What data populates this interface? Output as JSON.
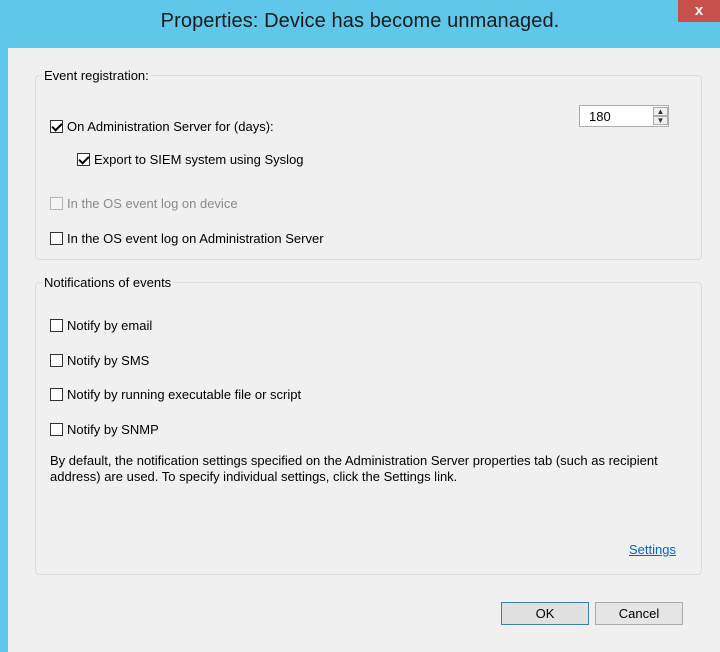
{
  "window": {
    "title": "Properties: Device has become unmanaged.",
    "close_label": "x"
  },
  "event_registration": {
    "legend": "Event registration:",
    "admin_server": {
      "label": "On Administration Server for (days):",
      "checked": true
    },
    "days_value": "180",
    "export_siem": {
      "label": "Export to SIEM system using Syslog",
      "checked": true
    },
    "os_log_device": {
      "label": "In the OS event log on device",
      "checked": false,
      "disabled": true
    },
    "os_log_admin": {
      "label": "In the OS event log on Administration Server",
      "checked": false
    }
  },
  "notifications": {
    "legend": "Notifications of events",
    "email": {
      "label": "Notify by email",
      "checked": false
    },
    "sms": {
      "label": "Notify by SMS",
      "checked": false
    },
    "executable": {
      "label": "Notify by running executable file or script",
      "checked": false
    },
    "snmp": {
      "label": "Notify by SNMP",
      "checked": false
    },
    "description": "By default, the notification settings specified on the Administration Server properties tab (such as recipient address) are used. To specify individual settings, click the Settings link.",
    "settings_link": "Settings"
  },
  "buttons": {
    "ok": "OK",
    "cancel": "Cancel"
  }
}
